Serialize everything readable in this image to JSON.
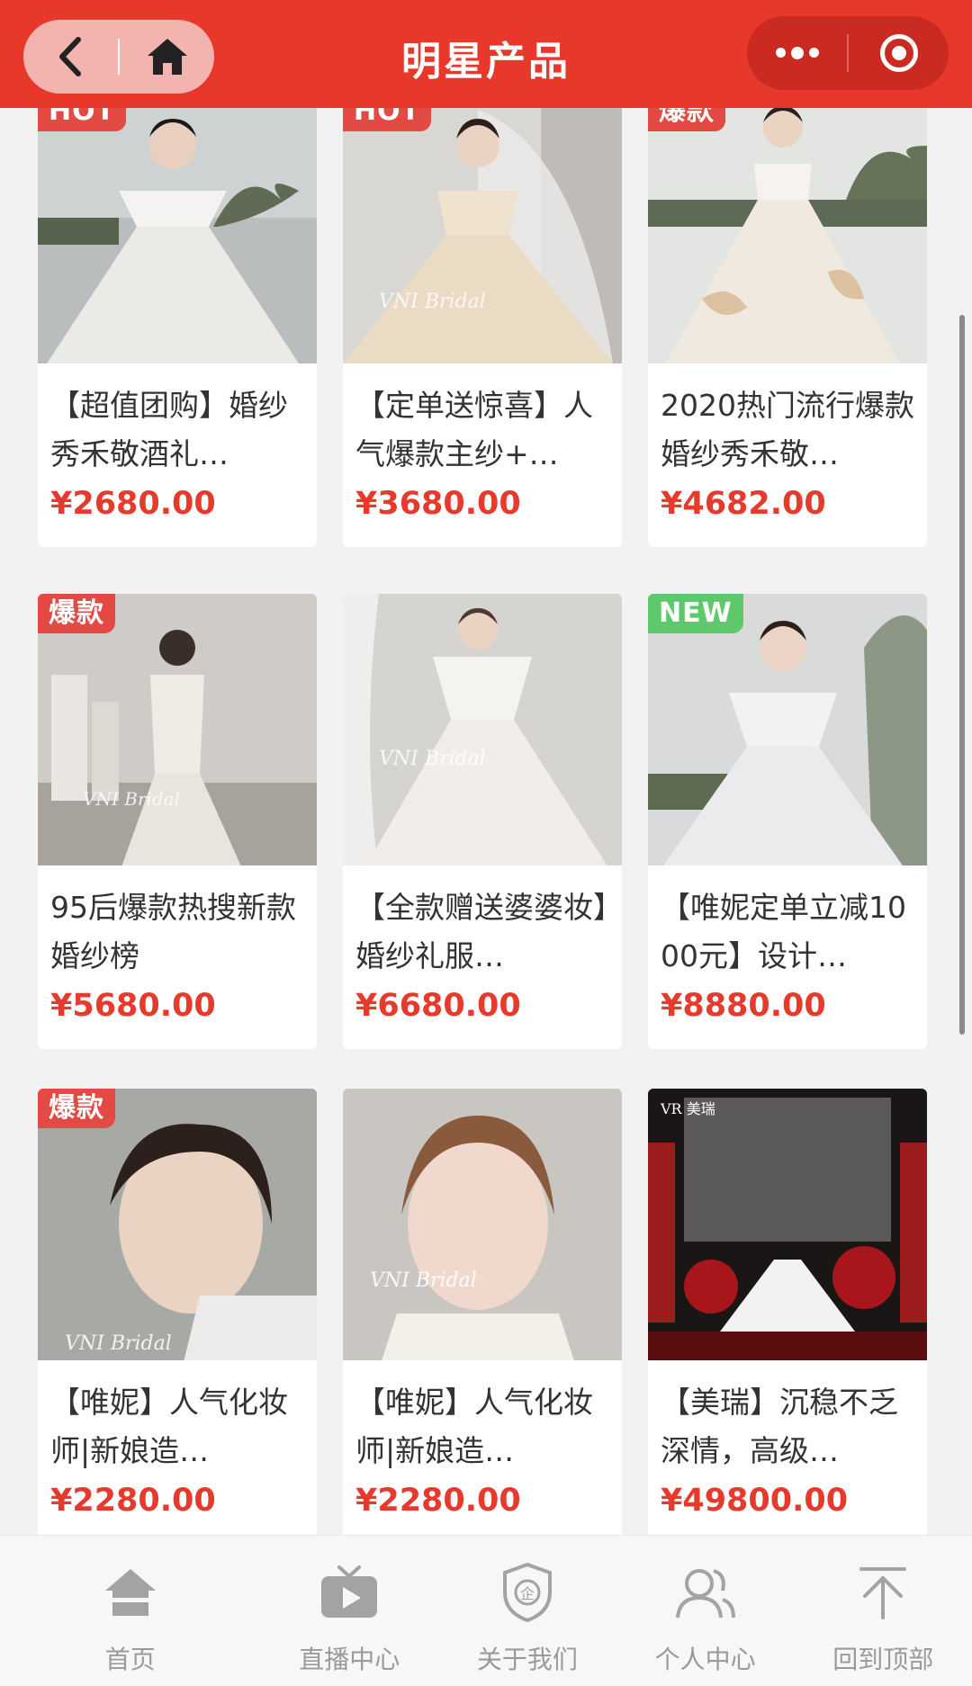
{
  "header": {
    "title": "明星产品",
    "back_icon": "chevron-left-icon",
    "home_icon": "home-icon",
    "more_icon": "more-dots-icon",
    "close_icon": "target-icon"
  },
  "products": [
    {
      "tag": "HOT",
      "tag_color": "#e44a44",
      "title": "【超值团购】婚纱秀禾敬酒礼…",
      "price": "¥2680.00"
    },
    {
      "tag": "HOT",
      "tag_color": "#e44a44",
      "title": "【定单送惊喜】人气爆款主纱+…",
      "price": "¥3680.00"
    },
    {
      "tag": "爆款",
      "tag_color": "#e44a44",
      "title": "2020热门流行爆款婚纱秀禾敬…",
      "price": "¥4682.00"
    },
    {
      "tag": "爆款",
      "tag_color": "#e44a44",
      "title": "95后爆款热搜新款婚纱榜",
      "price": "¥5680.00"
    },
    {
      "tag": "",
      "tag_color": "",
      "title": "【全款赠送婆婆妆】婚纱礼服…",
      "price": "¥6680.00"
    },
    {
      "tag": "NEW",
      "tag_color": "#5ec96a",
      "title": "【唯妮定单立减1000元】设计…",
      "price": "¥8880.00"
    },
    {
      "tag": "爆款",
      "tag_color": "#e44a44",
      "title": "【唯妮】人气化妆师|新娘造…",
      "price": "¥2280.00"
    },
    {
      "tag": "",
      "tag_color": "",
      "title": "【唯妮】人气化妆师|新娘造…",
      "price": "¥2280.00"
    },
    {
      "tag": "",
      "tag_color": "",
      "title": "【美瑞】沉稳不乏深情，高级…",
      "price": "¥49800.00"
    }
  ],
  "tabbar": [
    {
      "label": "首页",
      "icon": "home-icon"
    },
    {
      "label": "直播中心",
      "icon": "live-tv-icon"
    },
    {
      "label": "关于我们",
      "icon": "shield-enterprise-icon"
    },
    {
      "label": "个人中心",
      "icon": "users-icon"
    },
    {
      "label": "回到顶部",
      "icon": "back-to-top-icon"
    }
  ],
  "colors": {
    "brand": "#e8382c",
    "price": "#e53a2c",
    "tab_inactive": "#9a9a9a"
  }
}
